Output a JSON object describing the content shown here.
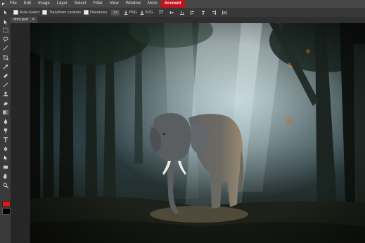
{
  "menu": {
    "file": "File",
    "edit": "Edit",
    "image": "Image",
    "layer": "Layer",
    "select": "Select",
    "filter": "Filter",
    "view": "View",
    "window": "Window",
    "more": "More",
    "account": "Account"
  },
  "options": {
    "auto_select": "Auto-Select",
    "transform_controls": "Transform controls",
    "distances": "Distances",
    "zoom": "1x",
    "png": "PNG",
    "svg": "SVG"
  },
  "document": {
    "tab_name": "shot.psd",
    "close_glyph": "✕"
  },
  "colors": {
    "accent": "#c1121f",
    "foreground": "#e01818",
    "background": "#000000"
  },
  "tools": [
    "move-icon",
    "marquee-icon",
    "lasso-icon",
    "magic-wand-icon",
    "crop-icon",
    "eyedropper-icon",
    "healing-icon",
    "brush-icon",
    "stamp-icon",
    "eraser-icon",
    "gradient-icon",
    "blur-icon",
    "dodge-icon",
    "pen-icon",
    "type-icon",
    "path-select-icon",
    "shape-icon",
    "hand-icon",
    "zoom-icon"
  ]
}
